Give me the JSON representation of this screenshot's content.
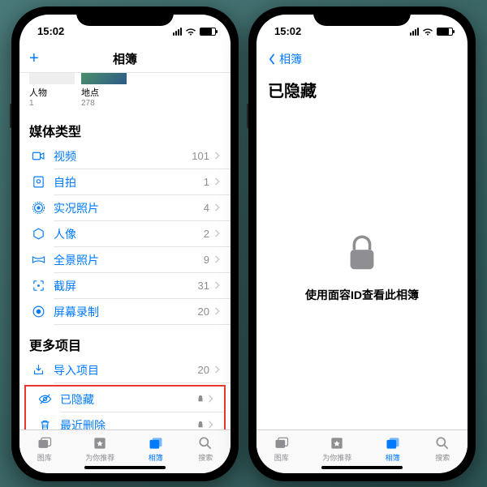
{
  "status": {
    "time": "15:02"
  },
  "left": {
    "nav_title": "相簿",
    "thumbs": {
      "people": {
        "label": "人物",
        "count": "1"
      },
      "places": {
        "label": "地点",
        "count": "278"
      }
    },
    "media_types_header": "媒体类型",
    "media_types": [
      {
        "icon": "video",
        "label": "视频",
        "count": "101"
      },
      {
        "icon": "selfie",
        "label": "自拍",
        "count": "1"
      },
      {
        "icon": "live",
        "label": "实况照片",
        "count": "4"
      },
      {
        "icon": "portrait",
        "label": "人像",
        "count": "2"
      },
      {
        "icon": "pano",
        "label": "全景照片",
        "count": "9"
      },
      {
        "icon": "screenshot",
        "label": "截屏",
        "count": "31"
      },
      {
        "icon": "record",
        "label": "屏幕录制",
        "count": "20"
      }
    ],
    "more_header": "更多项目",
    "more_items": {
      "import": {
        "label": "导入项目",
        "count": "20"
      },
      "hidden": {
        "label": "已隐藏"
      },
      "deleted": {
        "label": "最近删除"
      }
    }
  },
  "right": {
    "back_label": "相簿",
    "title": "已隐藏",
    "message": "使用面容ID查看此相簿"
  },
  "tabs": {
    "library": "图库",
    "for_you": "为你推荐",
    "albums": "相簿",
    "search": "搜索"
  }
}
